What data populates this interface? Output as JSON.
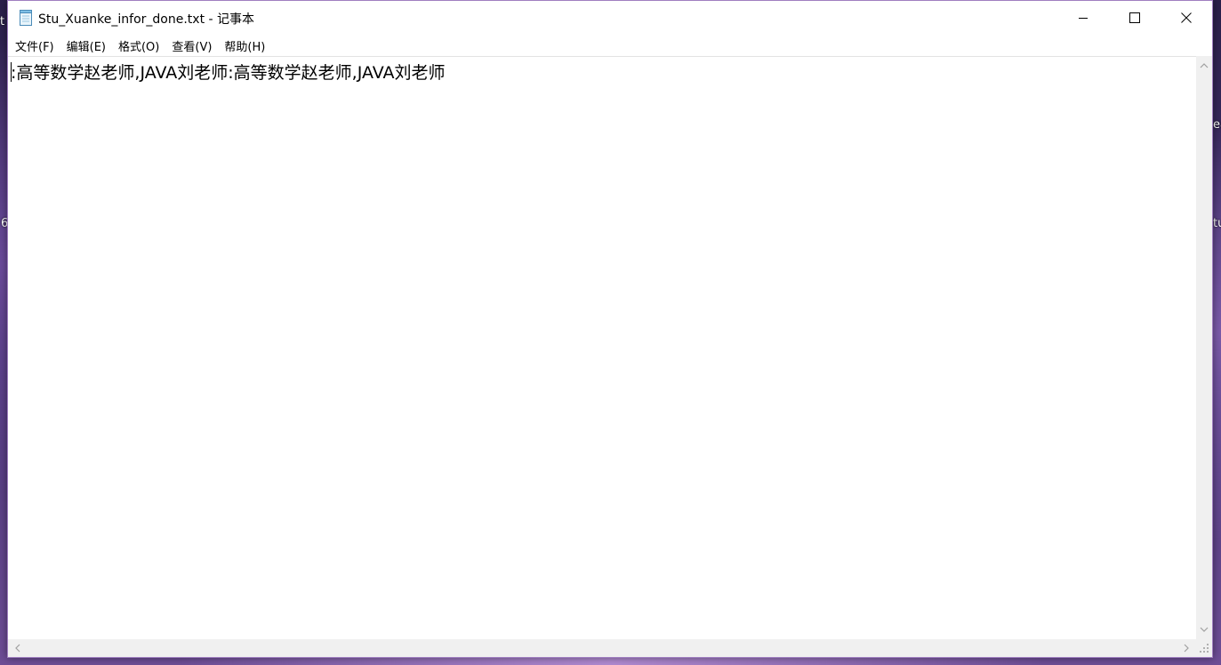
{
  "window": {
    "title": "Stu_Xuanke_infor_done.txt - 记事本"
  },
  "menu": [
    {
      "label": "文件(F)"
    },
    {
      "label": "编辑(E)"
    },
    {
      "label": "格式(O)"
    },
    {
      "label": "查看(V)"
    },
    {
      "label": "帮助(H)"
    }
  ],
  "editor": {
    "content": ":高等数学赵老师,JAVA刘老师:高等数学赵老师,JAVA刘老师"
  },
  "icons": {
    "app": "notepad-icon",
    "minimize": "minimize-icon",
    "maximize": "maximize-icon",
    "close": "close-icon",
    "scroll_up": "chevron-up-icon",
    "scroll_down": "chevron-down-icon",
    "scroll_left": "chevron-left-icon",
    "scroll_right": "chevron-right-icon",
    "resize": "resize-grip-icon"
  },
  "desktop_fragments": [
    "t",
    "6",
    "ea",
    "tu"
  ]
}
